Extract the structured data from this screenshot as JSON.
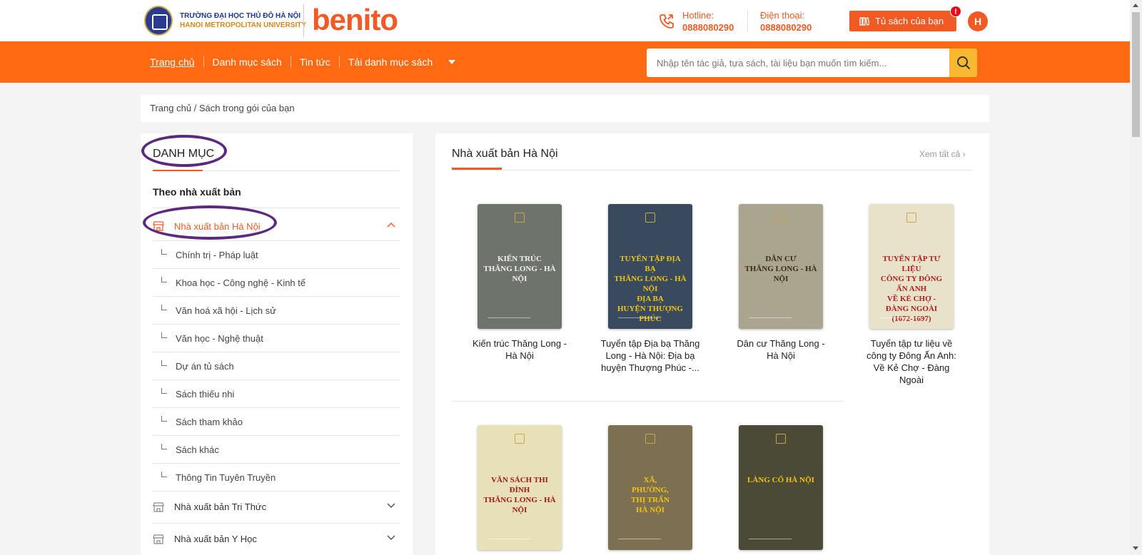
{
  "header": {
    "university_line1": "TRƯỜNG ĐẠI HỌC THỦ ĐÔ HÀ NỘI",
    "university_line2": "HANOI METROPOLITAN UNIVERSITY",
    "brand": "benito",
    "hotline_label": "Hotline:",
    "hotline_value": "0888080290",
    "phone_label": "Điện thoại:",
    "phone_value": "0888080290",
    "shelf_button": "Tủ sách của bạn",
    "badge": "!",
    "avatar_initial": "H"
  },
  "nav": {
    "items": [
      "Trang chủ",
      "Danh mục sách",
      "Tin tức",
      "Tải danh mục sách"
    ],
    "search_placeholder": "Nhập tên tác giả, tựa sách, tài liệu bạn muốn tìm kiếm..."
  },
  "breadcrumb": "Trang chủ / Sách trong gói của bạn",
  "sidebar": {
    "title": "DANH MỤC",
    "subtitle": "Theo nhà xuất bản",
    "publishers": [
      {
        "label": "Nhà xuất bản Hà Nội",
        "expanded": true
      },
      {
        "label": "Nhà xuất bản Tri Thức",
        "expanded": false
      },
      {
        "label": "Nhà xuất bản Y Học",
        "expanded": false
      }
    ],
    "subcategories": [
      "Chính trị - Pháp luật",
      "Khoa học - Công nghệ - Kinh tế",
      "Văn hoá xã hội - Lịch sử",
      "Văn học - Nghệ thuật",
      "Dự án tủ sách",
      "Sách thiếu nhi",
      "Sách tham khảo",
      "Sách khác",
      "Thông Tin Tuyên Truyền"
    ]
  },
  "section": {
    "title": "Nhà xuất bản Hà Nội",
    "see_all": "Xem tất cả",
    "books": [
      {
        "title": "Kiến trúc Thăng Long - Hà Nội",
        "cover_text": "KIẾN TRÚC\nTHĂNG LONG - HÀ NỘI",
        "cover_color": "#6e736b",
        "text_color": "#f2f2f2"
      },
      {
        "title": "Tuyển tập Địa bạ Thăng Long - Hà Nội: Địa bạ huyện Thượng Phúc -...",
        "cover_text": "TUYỂN TẬP ĐỊA BẠ\nTHĂNG LONG - HÀ NỘI\nĐỊA BẠ\nHUYỆN THƯỢNG PHÚC",
        "cover_color": "#394a5e",
        "text_color": "#f1c40f"
      },
      {
        "title": "Dân cư Thăng Long - Hà Nội",
        "cover_text": "DÂN CƯ\nTHĂNG LONG - HÀ NỘI",
        "cover_color": "#a9a58f",
        "text_color": "#3b2a1a"
      },
      {
        "title": "Tuyển tập tư liệu về công ty Đông Ấn Anh: Về Kẻ Chợ - Đàng Ngoài",
        "cover_text": "TUYỂN TẬP TƯ LIỆU\nCÔNG TY ĐÔNG ẤN ANH\nVỀ KẺ CHỢ - ĐÀNG NGOÀI\n(1672-1697)",
        "cover_color": "#e9e2cb",
        "text_color": "#b01e1e"
      },
      {
        "title": "",
        "cover_text": "VĂN SÁCH THI ĐÌNH\nTHĂNG LONG - HÀ NỘI",
        "cover_color": "#e8e0b8",
        "text_color": "#a01818"
      },
      {
        "title": "",
        "cover_text": "XÃ,\nPHƯỜNG,\nTHỊ TRẤN\nHÀ NỘI",
        "cover_color": "#7d6f52",
        "text_color": "#f1c40f"
      },
      {
        "title": "",
        "cover_text": "LÀNG CỔ HÀ NỘI",
        "cover_color": "#4a4a36",
        "text_color": "#f1c40f"
      }
    ]
  },
  "colors": {
    "accent": "#ff6a13",
    "brand": "#f15a24",
    "search_button": "#f7b932",
    "annotation_ring": "#5b2a7e"
  },
  "icons": {
    "phone": "phone-icon",
    "shelf": "bookshelf-icon",
    "search": "search-icon",
    "store": "store-icon",
    "chevron_up": "chevron-up-icon",
    "chevron_down": "chevron-down-icon",
    "chevron_right": "chevron-right-icon"
  }
}
